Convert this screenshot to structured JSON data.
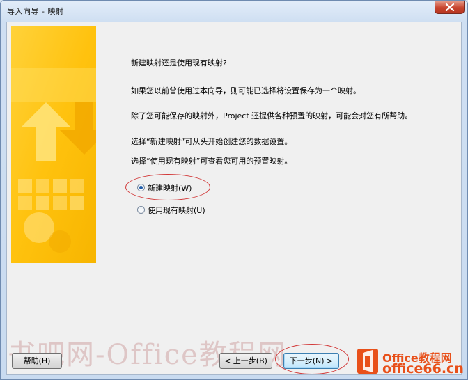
{
  "window": {
    "title": "导入向导 - 映射"
  },
  "content": {
    "question": "新建映射还是使用现有映射?",
    "line1": "如果您以前曾使用过本向导，则可能已选择将设置保存为一个映射。",
    "line2": "除了您可能保存的映射外，Project 还提供各种预置的映射，可能会对您有所帮助。",
    "line3": "选择“新建映射”可从头开始创建您的数据设置。",
    "line4": "选择“使用现有映射”可查看您可用的预置映射。"
  },
  "options": [
    {
      "label": "新建映射(W)",
      "selected": true
    },
    {
      "label": "使用现有映射(U)",
      "selected": false
    }
  ],
  "buttons": {
    "help": "帮助(H)",
    "back": "< 上一步(B)",
    "next": "下一步(N) >"
  },
  "watermark": {
    "text": "书吧网-Office教程网"
  },
  "logo": {
    "line1": "Office教程网",
    "line2": "office66.cn"
  },
  "colors": {
    "banner": "#ffc20e",
    "accent": "#e8501a",
    "highlight_circle": "#d23a3a"
  }
}
